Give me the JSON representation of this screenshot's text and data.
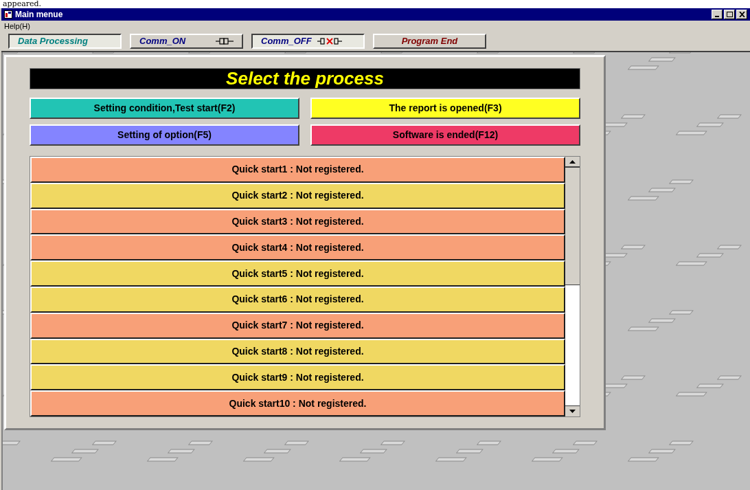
{
  "caption_fragment": "appeared.",
  "window": {
    "title": "Main menue"
  },
  "menu": [
    {
      "label": "Help(H)"
    }
  ],
  "toolbar": [
    {
      "label": "Data Processing",
      "kind": "processing",
      "pressed": true
    },
    {
      "label": "Comm_ON",
      "kind": "comm_on",
      "pressed": false
    },
    {
      "label": "Comm_OFF",
      "kind": "comm_off",
      "pressed": true
    },
    {
      "label": "Program End",
      "kind": "end",
      "pressed": false
    }
  ],
  "heading": "Select the process",
  "actions": [
    {
      "label": "Setting condition,Test start(F2)",
      "color": "#22c4b4"
    },
    {
      "label": "The report is opened(F3)",
      "color": "#ffff22"
    },
    {
      "label": "Setting of option(F5)",
      "color": "#8484ff"
    },
    {
      "label": "Software is ended(F12)",
      "color": "#ee3a66"
    }
  ],
  "quick_starts": [
    {
      "label": "Quick start1 : Not registered.",
      "color": "#f8a078"
    },
    {
      "label": "Quick start2 : Not registered.",
      "color": "#f0d862"
    },
    {
      "label": "Quick start3 : Not registered.",
      "color": "#f8a078"
    },
    {
      "label": "Quick start4 : Not registered.",
      "color": "#f8a078"
    },
    {
      "label": "Quick start5 : Not registered.",
      "color": "#f0d862"
    },
    {
      "label": "Quick start6 : Not registered.",
      "color": "#f0d862"
    },
    {
      "label": "Quick start7 : Not registered.",
      "color": "#f8a078"
    },
    {
      "label": "Quick start8 : Not registered.",
      "color": "#f0d862"
    },
    {
      "label": "Quick start9 : Not registered.",
      "color": "#f0d862"
    },
    {
      "label": "Quick start10 : Not registered.",
      "color": "#f8a078"
    }
  ]
}
